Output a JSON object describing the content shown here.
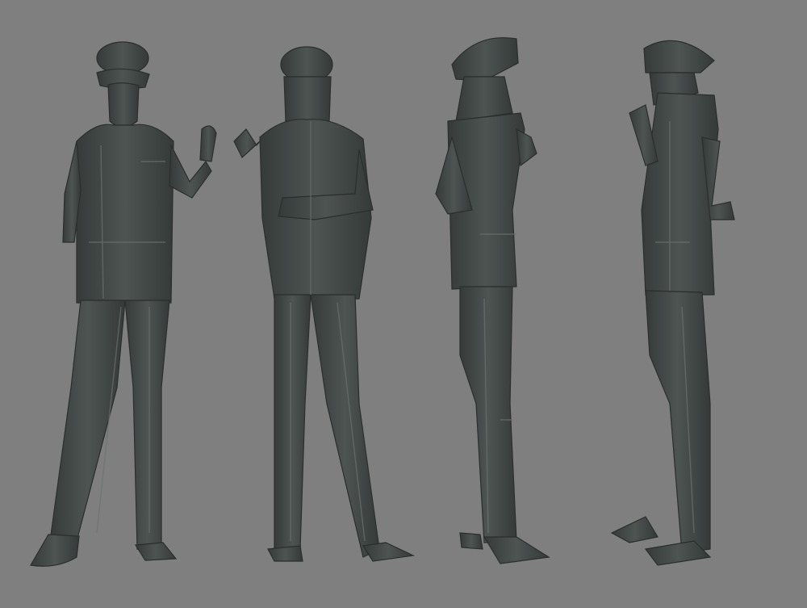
{
  "colors": {
    "background": "#7f7f7f",
    "model": "#414745",
    "model_shadow": "#2a2e2d",
    "model_highlight": "#6b726f"
  }
}
